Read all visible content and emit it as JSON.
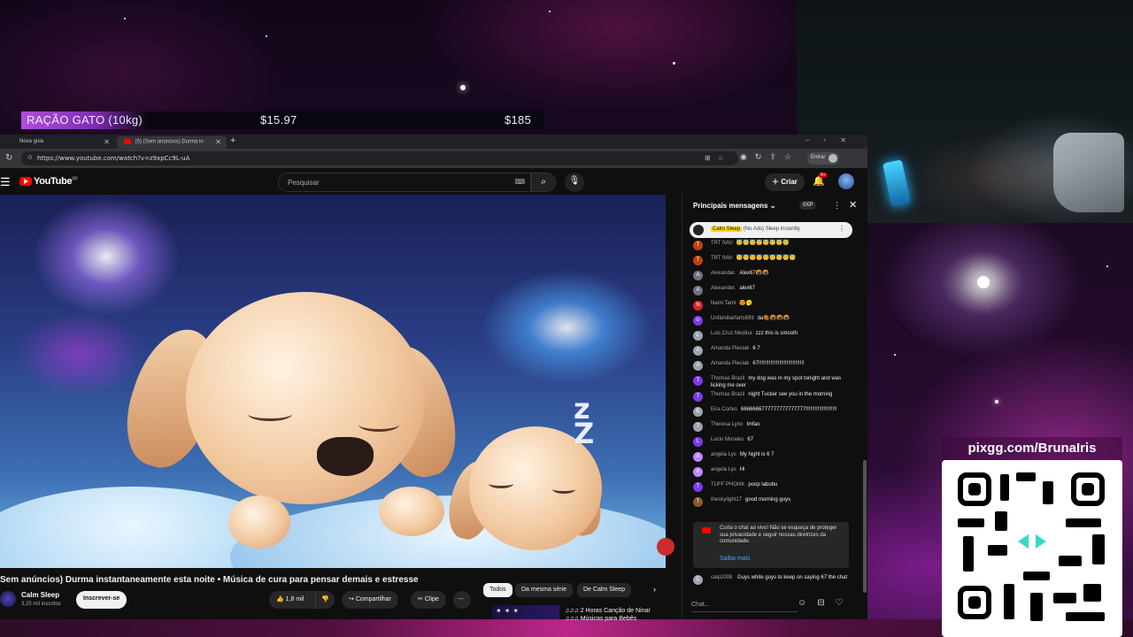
{
  "ticker": {
    "item_name": "RAÇÃO GATO (10kg)",
    "price_unit": "$15.97",
    "price_total": "$185"
  },
  "browser": {
    "tabs": [
      {
        "label": "Nova guia"
      },
      {
        "label": "(5) (Sem anúncios) Durma in"
      }
    ],
    "url": "https://www.youtube.com/watch?v=z9xpCc9L-uA",
    "signin_label": "Entrar"
  },
  "youtube": {
    "logo_text": "YouTube",
    "country_code": "BR",
    "search_placeholder": "Pesquisar",
    "create_label": "Criar",
    "notification_count": "9+",
    "video": {
      "title": "Sem anúncios) Durma instantaneamente esta noite • Música de cura para pensar demais e estresse",
      "channel": "Calm Sleep",
      "subscribers": "3,25 mil inscritos",
      "subscribe_label": "Inscrever-se",
      "likes": "1,8 mil",
      "share_label": "Compartilhar",
      "clip_label": "Clipe"
    },
    "chips": [
      {
        "label": "Todos",
        "selected": true
      },
      {
        "label": "Da mesma série",
        "selected": false
      },
      {
        "label": "De Calm Sleep",
        "selected": false
      }
    ],
    "up_next": {
      "title_line1": "♫♫♫ 2 Horas Canção de Ninar",
      "title_line2": "♫♫♫ Músicas para Bebês"
    }
  },
  "chat": {
    "header": "Principais mensagens",
    "xp_badge": "0XP",
    "pinned_author": "Calm Sleep",
    "pinned_text": "(No Ads) Sleep instantly",
    "messages": [
      {
        "author": "TRT fofo!",
        "text": "😇😇😇😇😇😇😇😇",
        "color": "#c2410c",
        "initial": "T"
      },
      {
        "author": "TRT fofo!",
        "text": "😇😇😇😇😇😇😇😇😇",
        "color": "#c2410c",
        "initial": "T"
      },
      {
        "author": "Alexander.",
        "text": "Alex67🍘🍘",
        "color": "#6b7280",
        "initial": "A"
      },
      {
        "author": "Alexander.",
        "text": "alex67",
        "color": "#6b7280",
        "initial": "A"
      },
      {
        "author": "Nami Tami",
        "text": "😍🥱",
        "color": "#dc2626",
        "initial": "N"
      },
      {
        "author": "Unfamiliarfarts699",
        "text": "da🍓🍘🍘🍘",
        "color": "#7c3aed",
        "initial": "U"
      },
      {
        "author": "Luis Cruz Medina",
        "text": "zzz this is smooth",
        "color": "#9ca3af",
        "initial": "L"
      },
      {
        "author": "Amanda Pieciak",
        "text": "6 7",
        "color": "#9ca3af",
        "initial": "A"
      },
      {
        "author": "Amanda Pieciak",
        "text": "67!!!!!!!!!!!!!!!!!!!!!!!!!!!!!!!",
        "color": "#9ca3af",
        "initial": "A"
      },
      {
        "author": "Thomas Brazil",
        "text": "my dog was in my spot tonight and was licking me over",
        "color": "#7c3aed",
        "initial": "T"
      },
      {
        "author": "Thomas Brazil",
        "text": "night Tucker see you in the morning",
        "color": "#7c3aed",
        "initial": "T"
      },
      {
        "author": "Eira Cortes",
        "text": "6666666777777777777777!!!!!!!!!!!!!!!!!!!!!",
        "color": "#9ca3af",
        "initial": "E"
      },
      {
        "author": "Theresa Lynn",
        "text": "Imfao",
        "color": "#9ca3af",
        "initial": "T"
      },
      {
        "author": "Lucio Morales",
        "text": "67",
        "color": "#7c3aed",
        "initial": "L"
      },
      {
        "author": "angela Lys",
        "text": "My hight is 6 7",
        "color": "#c084fc",
        "initial": "A"
      },
      {
        "author": "angela Lys",
        "text": "Hi",
        "color": "#c084fc",
        "initial": "A"
      },
      {
        "author": "TUFF PHONK",
        "text": "poop labubu",
        "color": "#7c3aed",
        "initial": "T"
      },
      {
        "author": "theskylight17",
        "text": "good morning guys",
        "color": "#8b5a2b",
        "initial": "T"
      }
    ],
    "notice_text": "Curta o chat ao vivo! Não se esqueça de proteger sua privacidade e seguir nossas diretrizes da comunidade.",
    "notice_link": "Saiba mais",
    "last_message": {
      "author": "calp2008",
      "text": "Guys white guys to keep on saying 67 the chat",
      "color": "#9ca3af",
      "initial": "C"
    },
    "input_placeholder": "Chat..."
  },
  "donation": {
    "url_text": "pixgg.com/BrunaIris"
  }
}
